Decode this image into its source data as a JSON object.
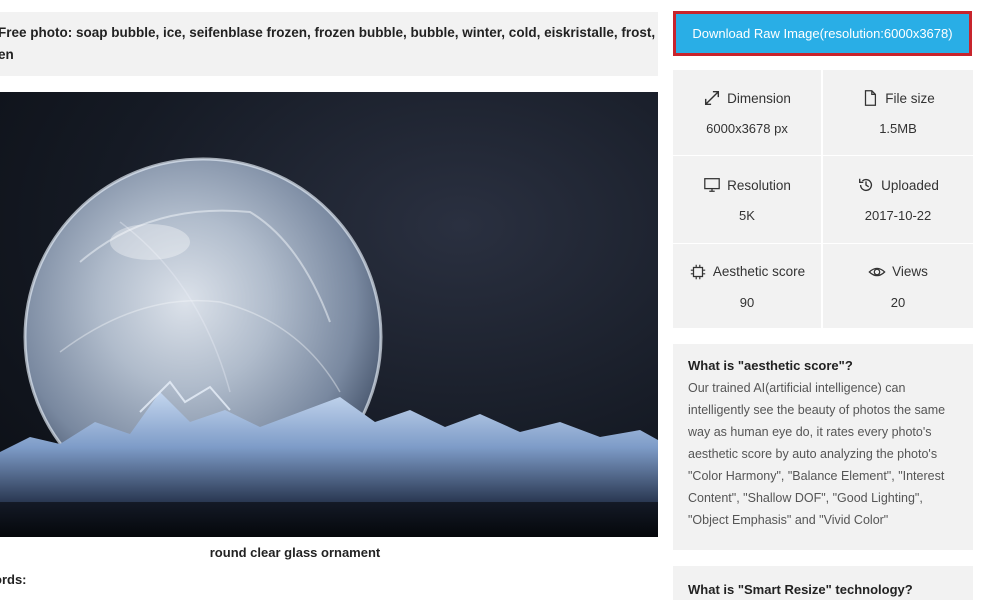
{
  "photo": {
    "title_line1": "Free photo: soap bubble, ice, seifenblase frozen, frozen bubble, bubble, winter, cold, eiskristalle, frost,",
    "title_line2": "en",
    "caption": "round clear glass ornament",
    "keywords_label": "ords:"
  },
  "download": {
    "label": "Download Raw Image(resolution:6000x3678)"
  },
  "info": {
    "dimension": {
      "label": "Dimension",
      "value": "6000x3678 px",
      "icon": "resize-arrows-icon"
    },
    "file_size": {
      "label": "File size",
      "value": "1.5MB",
      "icon": "file-icon"
    },
    "resolution": {
      "label": "Resolution",
      "value": "5K",
      "icon": "monitor-icon"
    },
    "uploaded": {
      "label": "Uploaded",
      "value": "2017-10-22",
      "icon": "history-icon"
    },
    "aesthetic": {
      "label": "Aesthetic score",
      "value": "90",
      "icon": "chip-icon"
    },
    "views": {
      "label": "Views",
      "value": "20",
      "icon": "eye-icon"
    }
  },
  "about_aesthetic": {
    "title": "What is \"aesthetic score\"?",
    "body": "Our trained AI(artificial intelligence) can intelligently see the beauty of photos the same way as human eye do, it rates every photo's aesthetic score by auto analyzing the photo's \"Color Harmony\", \"Balance Element\", \"Interest Content\", \"Shallow DOF\", \"Good Lighting\", \"Object Emphasis\" and \"Vivid Color\""
  },
  "about_smart_resize": {
    "title": "What is \"Smart Resize\" technology?"
  },
  "colors": {
    "download_bg": "#29aee6",
    "download_border": "#c8242c",
    "panel_bg": "#f2f2f2"
  }
}
